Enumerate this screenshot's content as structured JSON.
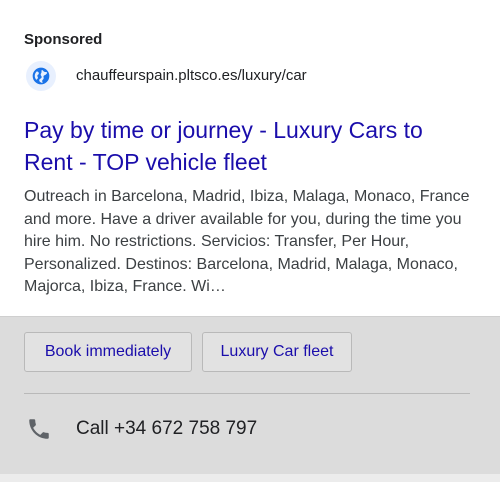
{
  "ad": {
    "sponsored_label": "Sponsored",
    "favicon": "globe-icon",
    "display_url": "chauffeurspain.pltsco.es/luxury/car",
    "headline": "Pay by time or journey - Luxury Cars to Rent - TOP vehicle fleet",
    "description": "Outreach in Barcelona, Madrid, Ibiza, Malaga, Monaco, France and more. Have a driver available for you, during the time you hire him. No restrictions. Servicios: Transfer, Per Hour, Personalized. Destinos: Barcelona, Madrid, Malaga, Monaco, Majorca, Ibiza, France. Wi…"
  },
  "sitelinks": [
    {
      "label": "Book immediately"
    },
    {
      "label": "Luxury Car fleet"
    }
  ],
  "call": {
    "icon": "phone-icon",
    "label": "Call +34 672 758 797"
  },
  "colors": {
    "link": "#1a0dab",
    "favicon": "#1a73e8",
    "text": "#202124",
    "panel": "#dcdcdc"
  }
}
